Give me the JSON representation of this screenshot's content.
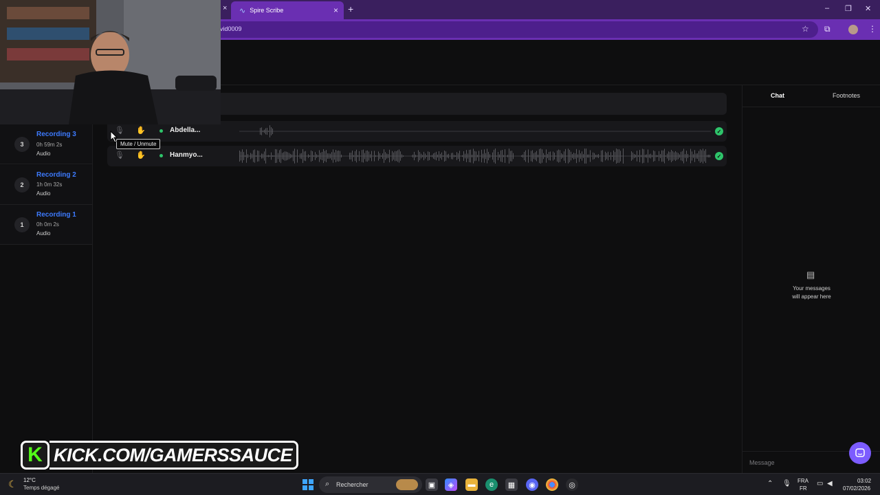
{
  "browser": {
    "tab_title": "Spire Scribe",
    "url_fragment": "vid0009",
    "close_glyph": "×",
    "new_tab_glyph": "+"
  },
  "sidebar": {
    "recordings": [
      {
        "number": "3",
        "title": "Recording 3",
        "duration": "0h 59m 2s",
        "type": "Audio"
      },
      {
        "number": "2",
        "title": "Recording 2",
        "duration": "1h 0m 32s",
        "type": "Audio"
      },
      {
        "number": "1",
        "title": "Recording 1",
        "duration": "0h 0m 2s",
        "type": "Audio"
      }
    ]
  },
  "tracks": [
    {
      "name": "Abdella...",
      "status": "done"
    },
    {
      "name": "Hanmyo...",
      "status": "done"
    }
  ],
  "tooltip": "Mute / Unmute",
  "right_panel": {
    "tabs": [
      "Chat",
      "Footnotes"
    ],
    "empty_line1": "Your messages",
    "empty_line2": "will appear here",
    "message_placeholder": "Message"
  },
  "overlay": {
    "kick_text": "KICK.COM/GAMERSSAUCE",
    "kick_letter": "K"
  },
  "taskbar": {
    "temperature": "12°C",
    "weather": "Temps dégagé",
    "search_label": "Rechercher",
    "lang_top": "FRA",
    "lang_bottom": "FR",
    "time": "03:02",
    "date": "07/02/2026"
  },
  "colors": {
    "accent_blue": "#3d7bff",
    "success_green": "#2ec46a",
    "browser_purple": "#6a2fb2",
    "kick_green": "#53fc18"
  }
}
